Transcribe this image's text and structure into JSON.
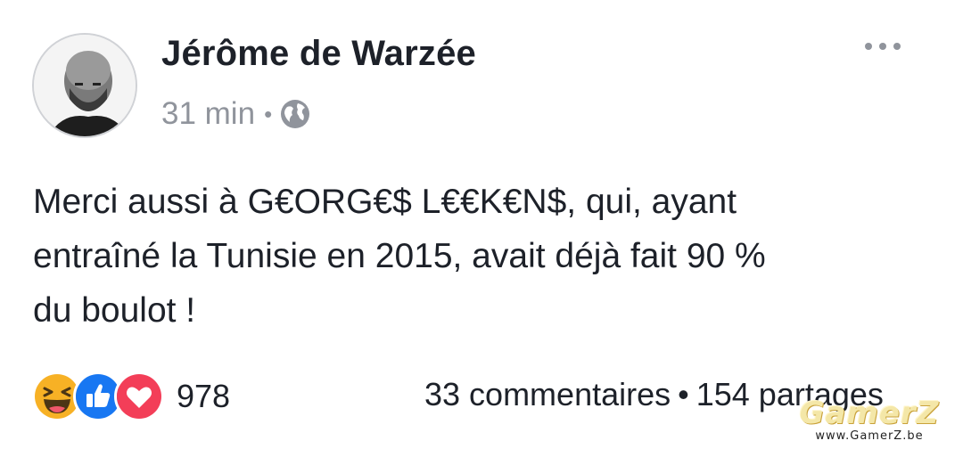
{
  "post": {
    "author": "Jérôme de Warzée",
    "time": "31 min",
    "separator": "•",
    "privacy_icon": "globe-icon",
    "more_icon": "more-options-icon",
    "lines": [
      "Merci aussi à G€ORG€$ L€€K€N$, qui, ayant",
      "entraîné la Tunisie en 2015, avait déjà fait 90 %",
      "du boulot !"
    ]
  },
  "reactions": {
    "icons": [
      "haha-icon",
      "like-icon",
      "love-icon"
    ],
    "count": "978",
    "colors": {
      "haha": "#f7b125",
      "like": "#1877f2",
      "love": "#f33e58"
    }
  },
  "stats": {
    "comments": "33 commentaires",
    "separator": "•",
    "shares": "154 partages"
  },
  "watermark": {
    "logo": "GamerZ",
    "url": "www.GamerZ.be"
  }
}
